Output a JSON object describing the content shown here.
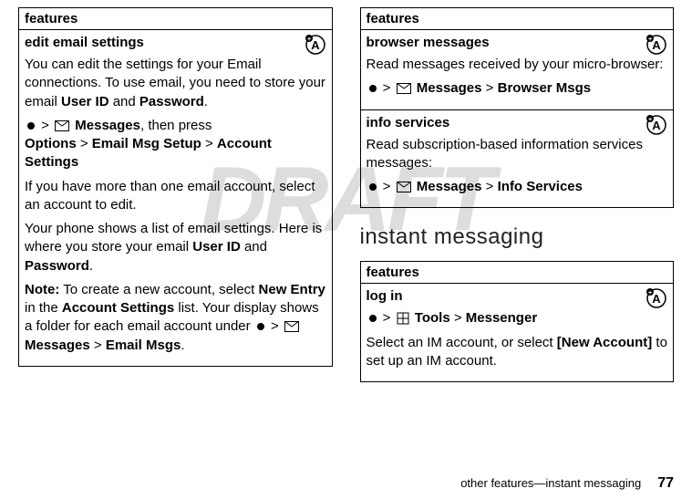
{
  "watermark": "DRAFT",
  "left": {
    "header": "features",
    "editEmail": {
      "title": "edit email settings",
      "p1_a": "You can edit the settings for your Email connections. To use email, you need to store your email ",
      "userId": "User ID",
      "and": " and ",
      "password": "Password",
      "period": ".",
      "nav_messages": "Messages",
      "nav_then": ", then press",
      "nav_options": "Options",
      "nav_emailSetup": "Email Msg Setup",
      "nav_accountSettings": "Account Settings",
      "p2": "If you have more than one email account, select an account to edit.",
      "p3_a": "Your phone shows a list of email settings. Here is where you store your email ",
      "note_label": "Note:",
      "note_a": " To create a new account, select ",
      "newEntry": "New Entry",
      "note_b": " in the ",
      "accountSettings2": "Account Settings",
      "note_c": " list. Your display shows a folder for each email account under ",
      "emailMsgs": "Email Msgs"
    }
  },
  "right": {
    "header": "features",
    "browserMsgs": {
      "title": "browser messages",
      "desc": "Read messages received by your micro-browser:",
      "messages": "Messages",
      "browserMsgs": "Browser Msgs"
    },
    "infoServices": {
      "title": "info services",
      "desc": "Read subscription-based information services messages:",
      "messages": "Messages",
      "infoServices": "Info Services"
    },
    "imHeading": "instant messaging",
    "imHeader": "features",
    "login": {
      "title": "log in",
      "tools": "Tools",
      "messenger": "Messenger",
      "desc_a": "Select an IM account, or select ",
      "newAccount": "[New Account]",
      "desc_b": " to set up an IM account."
    }
  },
  "footer": {
    "section": "other features—instant messaging",
    "page": "77"
  },
  "gt": ">"
}
